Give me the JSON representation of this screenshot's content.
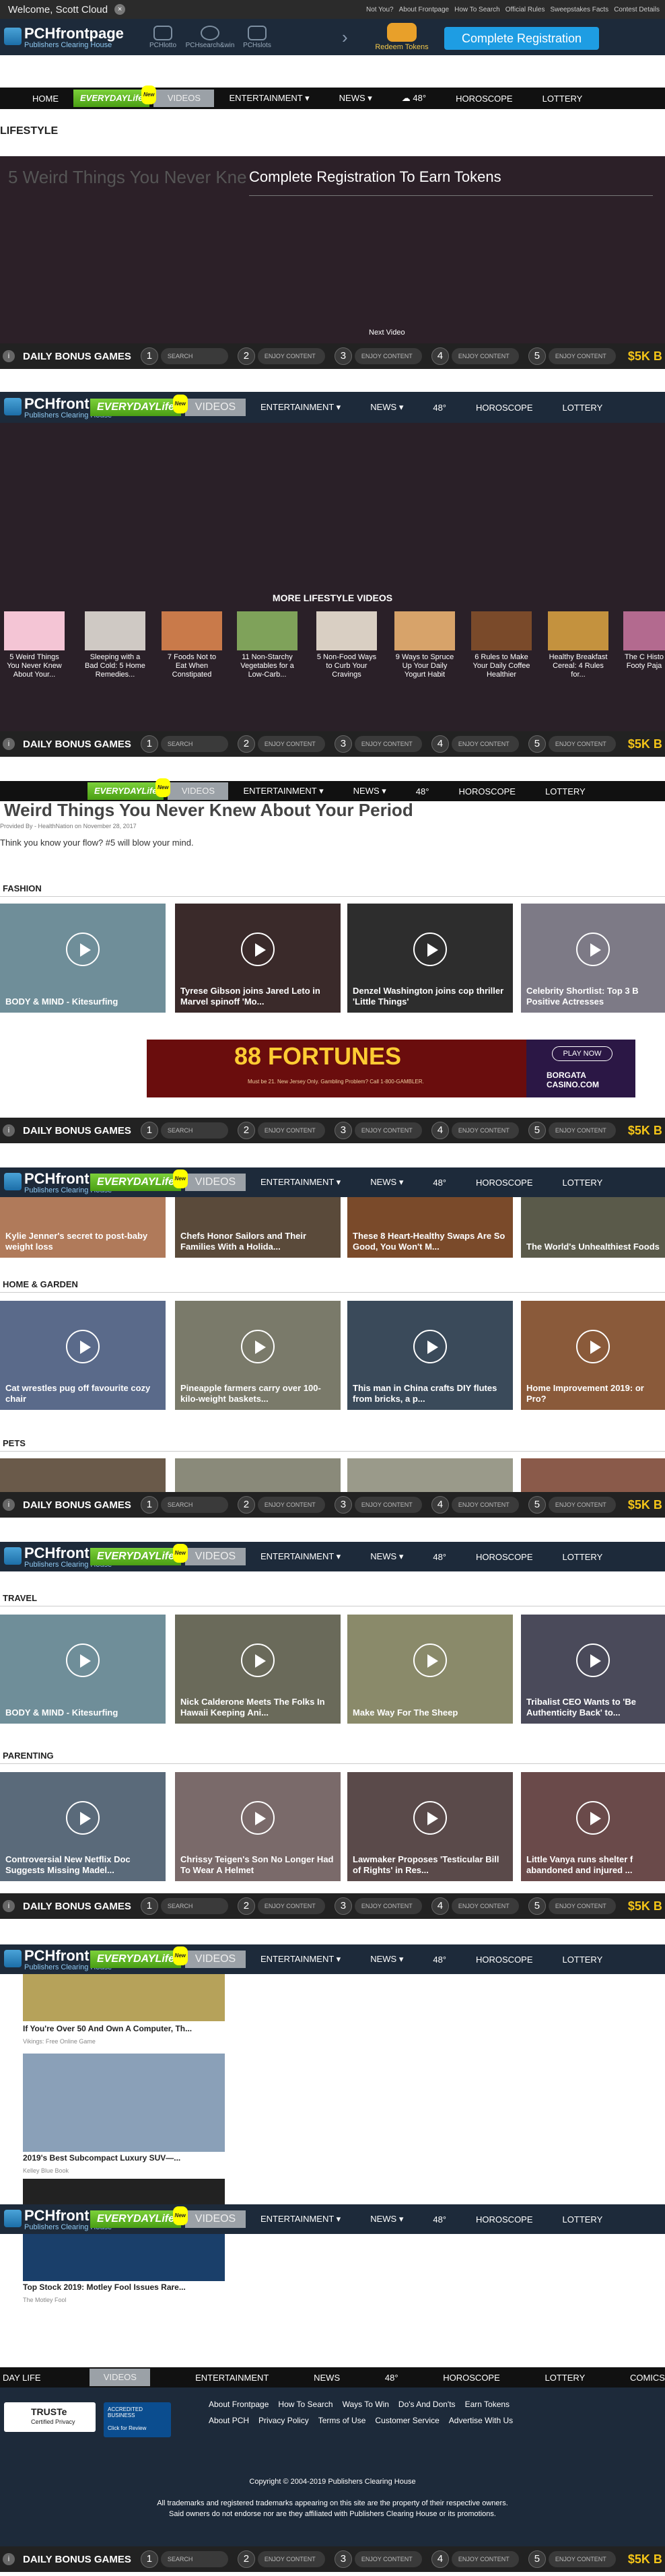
{
  "topbar": {
    "welcome": "Welcome, Scott Cloud",
    "links": [
      "Not You?",
      "About Frontpage",
      "How To Search",
      "Official Rules",
      "Sweepstakes Facts",
      "Contest Details"
    ]
  },
  "header": {
    "brand": "PCHfrontpage",
    "sub": "Publishers Clearing House",
    "icons": [
      "PCHlotto",
      "PCHsearch&win",
      "PCHslots"
    ],
    "redeem": "Redeem Tokens",
    "register": "Complete Registration"
  },
  "nav": {
    "home": "HOME",
    "everyday": "EVERYDAYLife",
    "new": "New",
    "videos": "VIDEOS",
    "entertainment": "ENTERTAINMENT ▾",
    "news": "NEWS ▾",
    "weather": "48°",
    "horoscope": "HOROSCOPE",
    "lottery": "LOTTERY"
  },
  "bonus": {
    "title": "DAILY BONUS GAMES",
    "steps": [
      {
        "num": "1",
        "label": "SEARCH"
      },
      {
        "num": "2",
        "label": "ENJOY CONTENT"
      },
      {
        "num": "3",
        "label": "ENJOY CONTENT"
      },
      {
        "num": "4",
        "label": "ENJOY CONTENT"
      },
      {
        "num": "5",
        "label": "ENJOY CONTENT"
      }
    ],
    "prize": "$5K B"
  },
  "lifestyle": {
    "title": "LIFESTYLE",
    "overlay": "Complete Registration To Earn Tokens",
    "video_title": "5 Weird Things You Never Kne",
    "next_video": "Next Video",
    "more": "MORE LIFESTYLE VIDEOS",
    "thumbs": [
      "5 Weird Things You Never Knew About Your...",
      "Sleeping with a Bad Cold: 5 Home Remedies...",
      "7 Foods Not to Eat When Constipated",
      "11 Non-Starchy Vegetables for a Low-Carb...",
      "5 Non-Food Ways to Curb Your Cravings",
      "9 Ways to Spruce Up Your Daily Yogurt Habit",
      "6 Rules to Make Your Daily Coffee Healthier",
      "Healthy Breakfast Cereal: 4 Rules for...",
      "The C Histo Footy Paja"
    ],
    "article_title": "Weird Things You Never Knew About Your Period",
    "provided": "Provided By - HealthNation on November 28, 2017",
    "desc": "Think you know your flow? #5 will blow your mind."
  },
  "fashion": {
    "title": "FASHION",
    "cards": [
      "BODY & MIND - Kitesurfing",
      "Tyrese Gibson joins Jared Leto in Marvel spinoff 'Mo...",
      "Denzel Washington joins cop thriller 'Little Things'",
      "Celebrity Shortlist: Top 3 B Positive Actresses"
    ]
  },
  "ad": {
    "title": "88 FORTUNES",
    "sub": "Must be 21. New Jersey Only. Gambling Problem? Call 1-800-GAMBLER.",
    "cta": "PLAY NOW",
    "brand": "BORGATA CASINO.COM"
  },
  "food": {
    "cards": [
      "Kylie Jenner's secret to post-baby weight loss",
      "Chefs Honor Sailors and Their Families With a Holida...",
      "These 8 Heart-Healthy Swaps Are So Good, You Won't M...",
      "The World's Unhealthiest Foods"
    ]
  },
  "home_garden": {
    "title": "HOME & GARDEN",
    "cards": [
      "Cat wrestles pug off favourite cozy chair",
      "Pineapple farmers carry over 100-kilo-weight baskets...",
      "This man in China crafts DIY flutes from bricks, a p...",
      "Home Improvement 2019: or Pro?"
    ]
  },
  "pets": {
    "title": "PETS"
  },
  "travel": {
    "title": "TRAVEL",
    "cards": [
      "BODY & MIND - Kitesurfing",
      "Nick Calderone Meets The Folks In Hawaii Keeping Ani...",
      "Make Way For The Sheep",
      "Tribalist CEO Wants to 'Be Authenticity Back' to..."
    ]
  },
  "parenting": {
    "title": "PARENTING",
    "cards": [
      "Controversial New Netflix Doc Suggests Missing Madel...",
      "Chrissy Teigen's Son No Longer Had To Wear A Helmet",
      "Lawmaker Proposes 'Testicular Bill of Rights' in Res...",
      "Little Vanya runs shelter f abandoned and injured ..."
    ]
  },
  "sponsored": [
    {
      "title": "If You're Over 50 And Own A Computer, Th...",
      "source": "Vikings: Free Online Game"
    },
    {
      "title": "2019's Best Subcompact Luxury SUV—...",
      "source": "Kelley Blue Book"
    },
    {
      "title": "Top Stock 2019: Motley Fool Issues Rare...",
      "source": "The Motley Fool"
    }
  ],
  "bottomnav": [
    "DAY LIFE",
    "VIDEOS",
    "ENTERTAINMENT",
    "NEWS",
    "48°",
    "HOROSCOPE",
    "LOTTERY",
    "COMICS"
  ],
  "footer": {
    "truste": "TRUSTe",
    "truste_sub": "Certified Privacy",
    "bbb": "ACCREDITED BUSINESS",
    "bbb_sub": "Click for Review",
    "row1": [
      "About Frontpage",
      "How To Search",
      "Ways To Win",
      "Do's And Don'ts",
      "Earn Tokens"
    ],
    "row2": [
      "About PCH",
      "Privacy Policy",
      "Terms of Use",
      "Customer Service",
      "Advertise With Us"
    ],
    "copyright": "Copyright © 2004-2019 Publishers Clearing House",
    "tm1": "All trademarks and registered trademarks appearing on this site are the property of their respective owners.",
    "tm2": "Said owners do not endorse nor are they affiliated with Publishers Clearing House or its promotions."
  },
  "colors": {
    "header_bg": "#1d2a3a",
    "nav_bg": "#111111",
    "bonus_bg": "#222222",
    "register": "#1e9de3",
    "everyday_green": "#5cb820",
    "prize_gold": "#f5c518"
  }
}
